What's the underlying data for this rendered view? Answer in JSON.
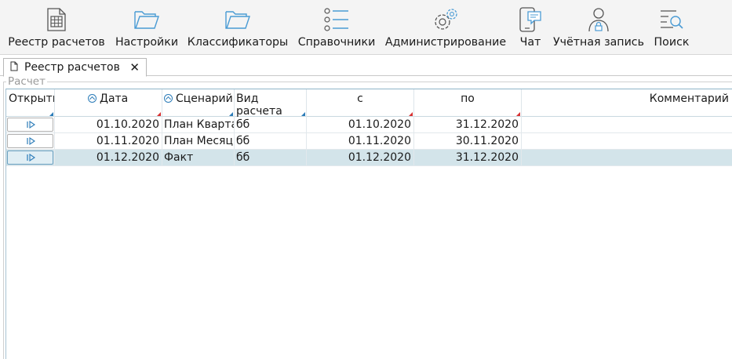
{
  "toolbar": {
    "items": [
      {
        "label": "Реестр расчетов",
        "icon": "spreadsheet-icon"
      },
      {
        "label": "Настройки",
        "icon": "folder-icon"
      },
      {
        "label": "Классификаторы",
        "icon": "folder-icon"
      },
      {
        "label": "Справочники",
        "icon": "list-icon"
      },
      {
        "label": "Администрирование",
        "icon": "gear-icon"
      },
      {
        "label": "Чат",
        "icon": "chat-phone-icon"
      },
      {
        "label": "Учётная запись",
        "icon": "user-lock-icon"
      },
      {
        "label": "Поиск",
        "icon": "search-list-icon"
      }
    ]
  },
  "tab": {
    "label": "Реестр расчетов",
    "close": "✕"
  },
  "group": {
    "caption": "Расчет"
  },
  "table": {
    "headers": {
      "open": "Открыть",
      "date": "Дата",
      "scenario": "Сценарий",
      "calc_type": "Вид расчета",
      "from": "с",
      "to": "по",
      "comment": "Комментарий"
    },
    "rows": [
      {
        "date": "01.10.2020",
        "scenario": "План Квартал",
        "calc_type": "бб",
        "from": "01.10.2020",
        "to": "31.12.2020",
        "comment": "",
        "selected": false
      },
      {
        "date": "01.11.2020",
        "scenario": "План Месяц",
        "calc_type": "бб",
        "from": "01.11.2020",
        "to": "30.11.2020",
        "comment": "",
        "selected": false
      },
      {
        "date": "01.12.2020",
        "scenario": "Факт",
        "calc_type": "бб",
        "from": "01.12.2020",
        "to": "31.12.2020",
        "comment": "",
        "selected": true
      }
    ]
  },
  "colors": {
    "accent": "#2a7bb8",
    "selected_row": "#d3e4ea",
    "required_marker": "#d83030"
  }
}
